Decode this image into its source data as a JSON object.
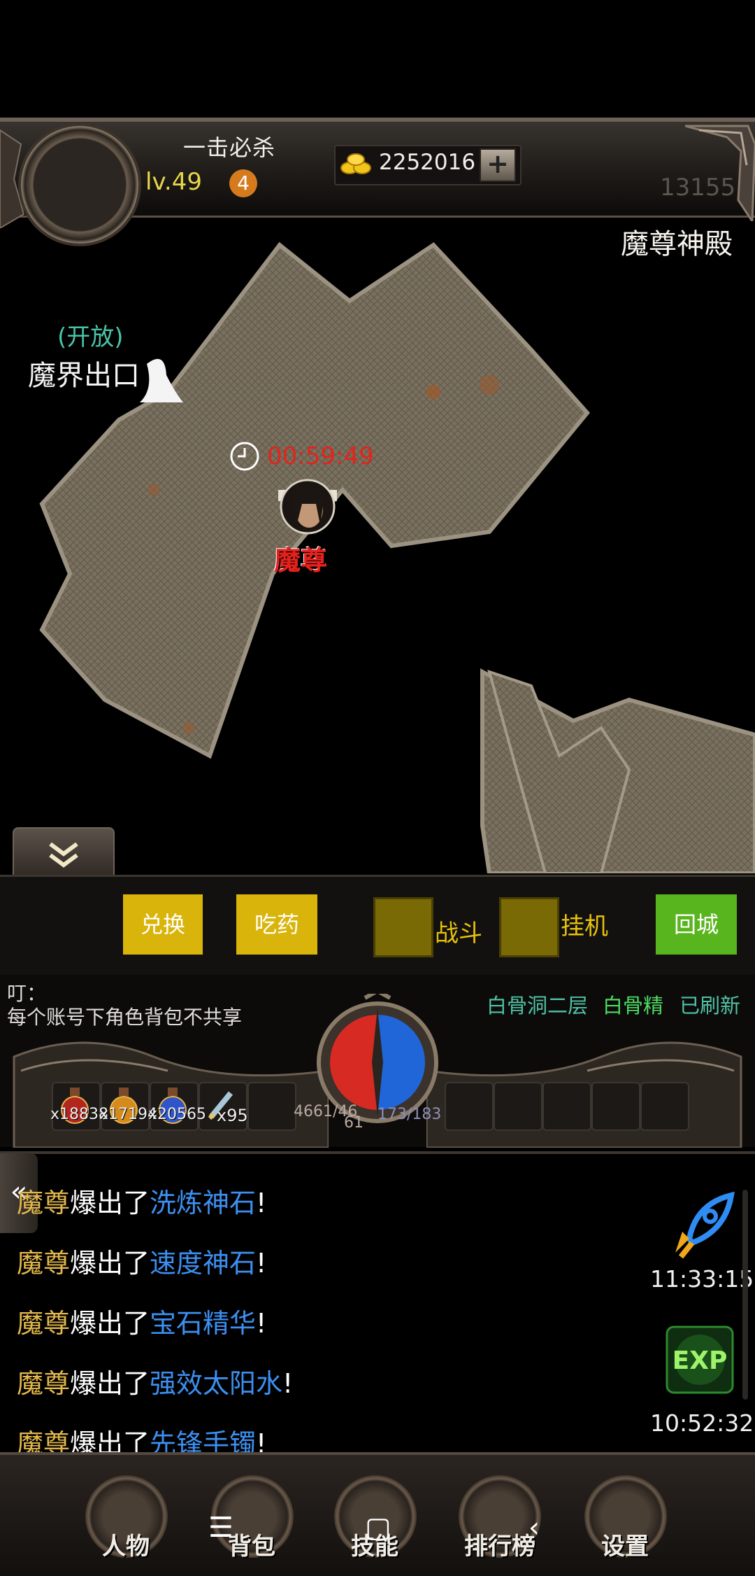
{
  "hud": {
    "player_name": "一击必杀",
    "level": "lv.49",
    "vip": "4",
    "gold": "2252016",
    "gold_plus": "+",
    "power": "13155",
    "map_name": "魔尊神殿"
  },
  "map": {
    "portal_status": "(开放)",
    "portal_name": "魔界出口",
    "boss_timer": "00:59:49",
    "boss_name": "魔尊"
  },
  "actions": {
    "exchange": "兑换",
    "potion": "吃药",
    "battle": "战斗",
    "idle": "挂机",
    "return_city": "回城"
  },
  "notice": {
    "title": "叮：",
    "text": "每个账号下角色背包不共享",
    "refresh_location": "白骨洞二层",
    "refresh_monster": "白骨精",
    "refresh_state": "已刷新"
  },
  "potions": [
    {
      "count": "x18838",
      "color": "#b3261e"
    },
    {
      "count": "x17194",
      "color": "#d58a1c"
    },
    {
      "count": "x20565",
      "color": "#2f55c9"
    }
  ],
  "scroll_count": "x95",
  "stats": {
    "hp_line1": "4661/46",
    "hp_line2": "61",
    "mp": "173/183"
  },
  "chat": [
    {
      "who": "魔尊",
      "verb": "爆出了",
      "item": "洗炼神石",
      "end": "!"
    },
    {
      "who": "魔尊",
      "verb": "爆出了",
      "item": "速度神石",
      "end": "!"
    },
    {
      "who": "魔尊",
      "verb": "爆出了",
      "item": "宝石精华",
      "end": "!"
    },
    {
      "who": "魔尊",
      "verb": "爆出了",
      "item": "强效太阳水",
      "end": "!"
    },
    {
      "who": "魔尊",
      "verb": "爆出了",
      "item": "先锋手镯",
      "end": "!"
    }
  ],
  "side": {
    "time1": "11:33:15",
    "time2": "10:52:32",
    "exp_label": "EXP"
  },
  "nav": {
    "character": "人物",
    "bag": "背包",
    "skills": "技能",
    "ranking": "排行榜",
    "settings": "设置"
  },
  "system_nav": {
    "menu": "☰",
    "home": "▢",
    "back": "‹"
  }
}
